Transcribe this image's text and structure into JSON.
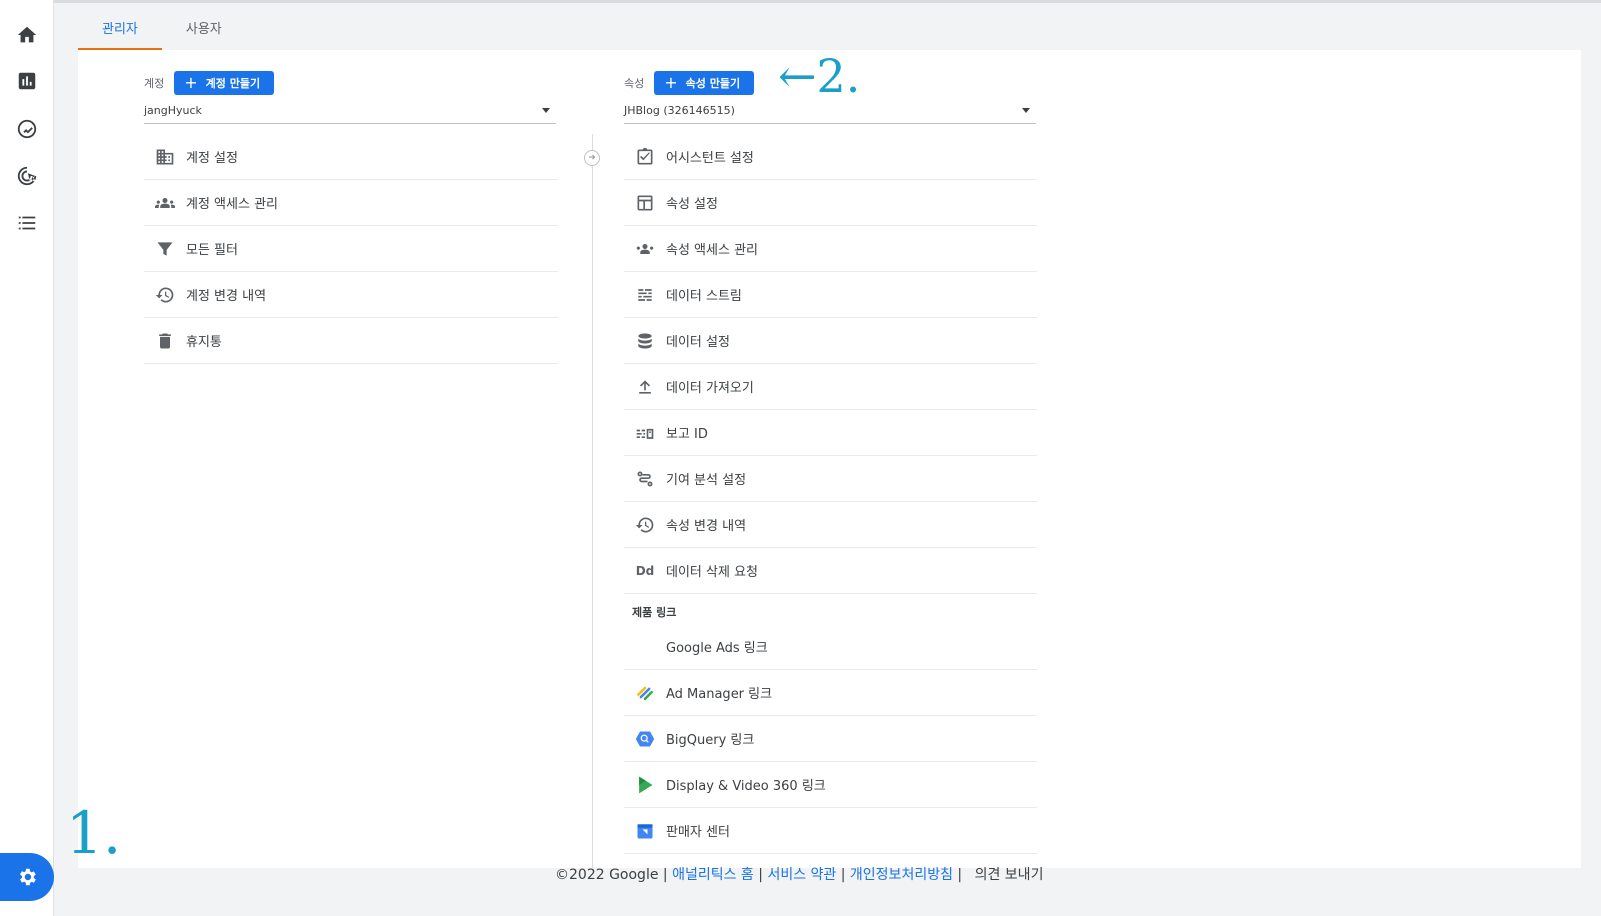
{
  "tabs": [
    {
      "label": "관리자",
      "active": true
    },
    {
      "label": "사용자",
      "active": false
    }
  ],
  "rail": {
    "items": [
      "home-icon",
      "reports-icon",
      "explore-icon",
      "advertising-icon",
      "configure-icon"
    ],
    "admin": "gear-icon"
  },
  "account": {
    "label": "계정",
    "create_label": "계정 만들기",
    "selected": "jangHyuck",
    "items": [
      {
        "icon": "building-icon",
        "label": "계정 설정"
      },
      {
        "icon": "people-icon",
        "label": "계정 액세스 관리"
      },
      {
        "icon": "filter-icon",
        "label": "모든 필터"
      },
      {
        "icon": "history-icon",
        "label": "계정 변경 내역"
      },
      {
        "icon": "trash-icon",
        "label": "휴지통"
      }
    ]
  },
  "property": {
    "label": "속성",
    "create_label": "속성 만들기",
    "selected": "JHBlog (326146515)",
    "items": [
      {
        "icon": "checklist-icon",
        "label": "어시스턴트 설정"
      },
      {
        "icon": "layout-icon",
        "label": "속성 설정"
      },
      {
        "icon": "people-icon",
        "label": "속성 액세스 관리"
      },
      {
        "icon": "streams-icon",
        "label": "데이터 스트림"
      },
      {
        "icon": "database-icon",
        "label": "데이터 설정"
      },
      {
        "icon": "upload-icon",
        "label": "데이터 가져오기"
      },
      {
        "icon": "reporting-id-icon",
        "label": "보고 ID"
      },
      {
        "icon": "attribution-icon",
        "label": "기여 분석 설정"
      },
      {
        "icon": "history-icon",
        "label": "속성 변경 내역"
      },
      {
        "icon": "dd-icon",
        "label": "데이터 삭제 요청"
      }
    ],
    "links_section_label": "제품 링크",
    "links": [
      {
        "icon": "google-ads-icon",
        "label": "Google Ads 링크"
      },
      {
        "icon": "ad-manager-icon",
        "label": "Ad Manager 링크"
      },
      {
        "icon": "bigquery-icon",
        "label": "BigQuery 링크"
      },
      {
        "icon": "display-video-icon",
        "label": "Display & Video 360 링크"
      },
      {
        "icon": "merchant-center-icon",
        "label": "판매자 센터"
      }
    ]
  },
  "footer": {
    "copyright": "©2022 Google |",
    "links": [
      "애널리틱스 홈",
      "서비스 약관",
      "개인정보처리방침"
    ],
    "feedback": "의견 보내기"
  },
  "annotations": {
    "one": "1.",
    "two": "←2."
  },
  "colors": {
    "primary": "#1a73e8",
    "tab_underline": "#e8710a",
    "annotation": "#1aa0c8"
  }
}
